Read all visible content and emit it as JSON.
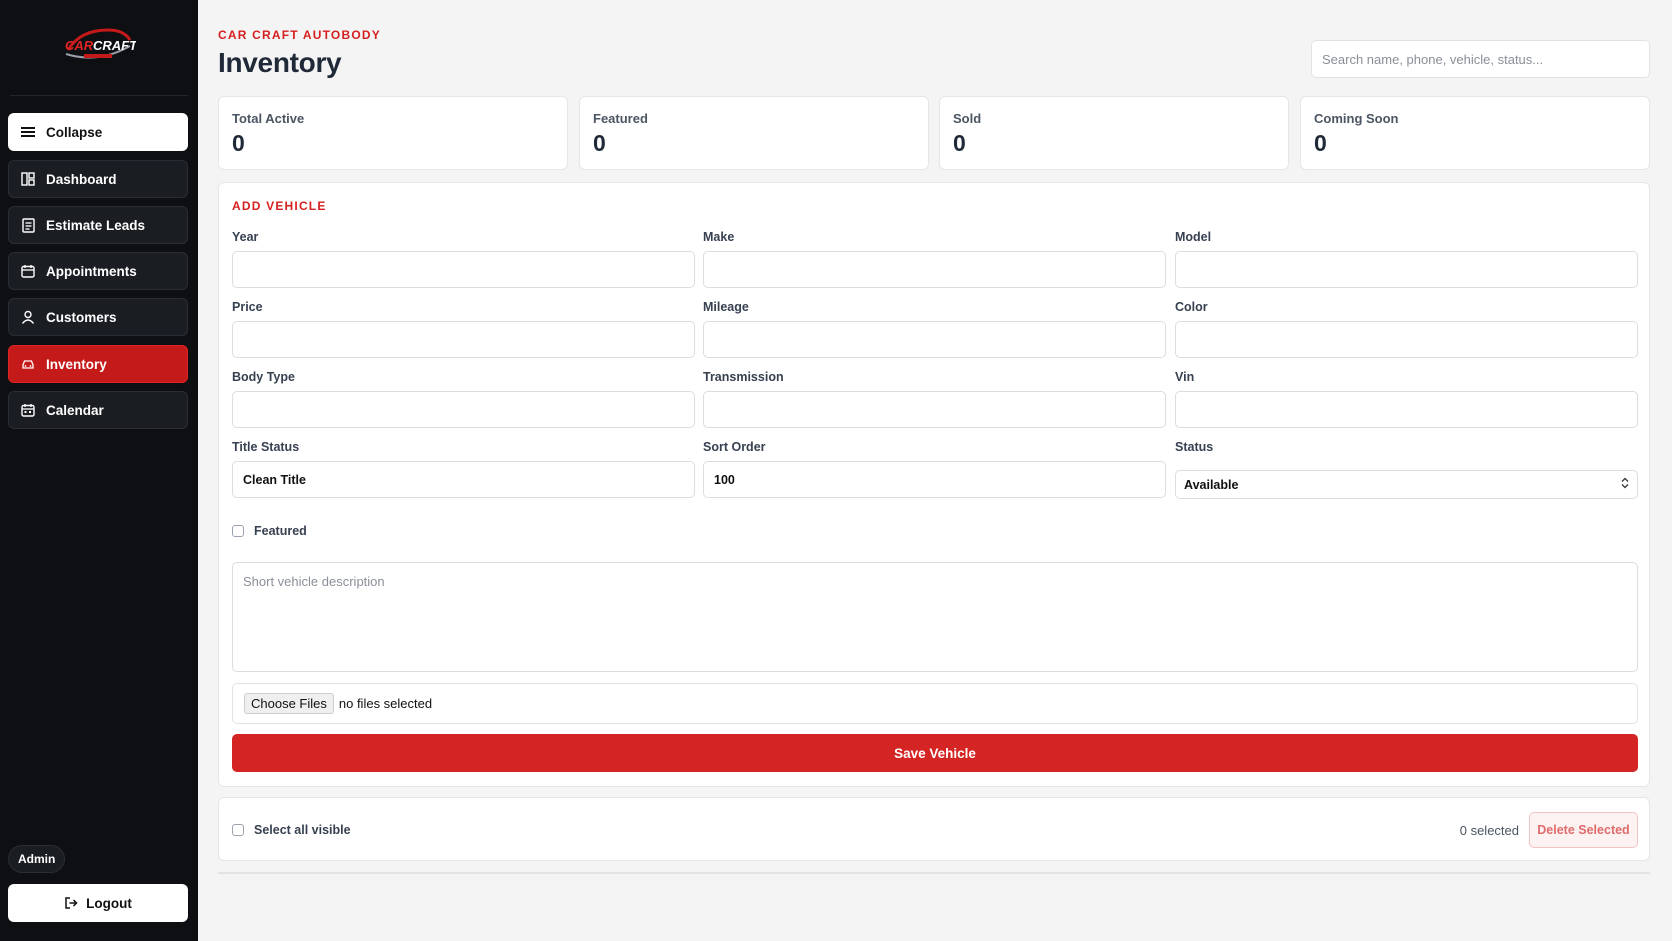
{
  "sidebar": {
    "logo_text": "CARCRAFT",
    "collapse_label": "Collapse",
    "items": [
      {
        "label": "Dashboard",
        "icon": "dashboard-icon"
      },
      {
        "label": "Estimate Leads",
        "icon": "document-icon"
      },
      {
        "label": "Appointments",
        "icon": "calendar-icon"
      },
      {
        "label": "Customers",
        "icon": "user-icon"
      },
      {
        "label": "Inventory",
        "icon": "car-icon",
        "active": true
      },
      {
        "label": "Calendar",
        "icon": "calendar-icon"
      }
    ],
    "role_badge": "Admin",
    "logout_label": "Logout"
  },
  "header": {
    "brand": "CAR CRAFT AUTOBODY",
    "title": "Inventory",
    "search_placeholder": "Search name, phone, vehicle, status..."
  },
  "stats": [
    {
      "label": "Total Active",
      "value": "0"
    },
    {
      "label": "Featured",
      "value": "0"
    },
    {
      "label": "Sold",
      "value": "0"
    },
    {
      "label": "Coming Soon",
      "value": "0"
    }
  ],
  "form": {
    "section_title": "ADD VEHICLE",
    "fields": {
      "year": {
        "label": "Year",
        "value": ""
      },
      "make": {
        "label": "Make",
        "value": ""
      },
      "model": {
        "label": "Model",
        "value": ""
      },
      "price": {
        "label": "Price",
        "value": ""
      },
      "mileage": {
        "label": "Mileage",
        "value": ""
      },
      "color": {
        "label": "Color",
        "value": ""
      },
      "body_type": {
        "label": "Body Type",
        "value": ""
      },
      "transmission": {
        "label": "Transmission",
        "value": ""
      },
      "vin": {
        "label": "Vin",
        "value": ""
      },
      "title_status": {
        "label": "Title Status",
        "value": "Clean Title"
      },
      "sort_order": {
        "label": "Sort Order",
        "value": "100"
      },
      "status": {
        "label": "Status",
        "value": "Available"
      }
    },
    "featured_label": "Featured",
    "description_placeholder": "Short vehicle description",
    "choose_files_label": "Choose Files",
    "files_status": "no files selected",
    "save_label": "Save Vehicle"
  },
  "bulk": {
    "select_all_label": "Select all visible",
    "selected_count": "0 selected",
    "delete_label": "Delete Selected"
  },
  "colors": {
    "accent": "#d42424",
    "sidebar_bg": "#0d0f13",
    "page_bg": "#f4f4f5"
  }
}
